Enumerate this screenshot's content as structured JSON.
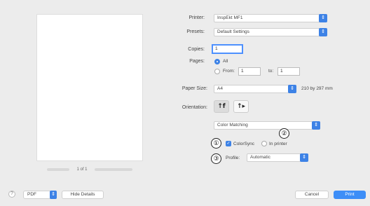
{
  "fields": {
    "printer": {
      "label": "Printer:",
      "value": "InspEkt MF1"
    },
    "presets": {
      "label": "Presets:",
      "value": "Default Settings"
    },
    "copies": {
      "label": "Copies:",
      "value": "1"
    },
    "pages": {
      "label": "Pages:",
      "all": "All",
      "from": "From:",
      "from_value": "1",
      "to": "to:",
      "to_value": "1"
    },
    "paper_size": {
      "label": "Paper Size:",
      "value": "A4",
      "dimensions": "210 by 297 mm"
    },
    "orientation": {
      "label": "Orientation:",
      "portrait_glyph": "↑f",
      "landscape_glyph": "↑▸"
    }
  },
  "section_menu": {
    "value": "Color Matching"
  },
  "color_sync": {
    "checkbox_label": "ColorSync",
    "in_printer_label": "In printer"
  },
  "profile": {
    "label": "Profile:",
    "value": "Automatic"
  },
  "callouts": [
    "①",
    "②",
    "③"
  ],
  "preview_nav": {
    "page_text": "1 of 1"
  },
  "bottom_bar": {
    "help": "?",
    "pdf": "PDF",
    "hide_details": "Hide Details",
    "cancel": "Cancel",
    "print": "Print"
  },
  "icons": {
    "chevron": "⇕",
    "check": "✓"
  },
  "colors": {
    "accent": "#3d82e6",
    "background": "#ececec"
  }
}
